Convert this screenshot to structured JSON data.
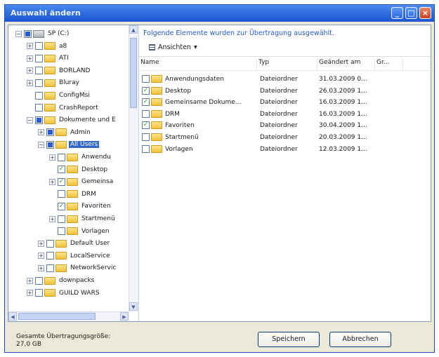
{
  "window": {
    "title": "Auswahl ändern"
  },
  "tree": {
    "rows": [
      {
        "label": "SP (C:)",
        "depth": 0,
        "exp": "−",
        "check": "part",
        "icon": "drive"
      },
      {
        "label": "a8",
        "depth": 1,
        "exp": "+",
        "check": "none",
        "icon": "folder"
      },
      {
        "label": "ATI",
        "depth": 1,
        "exp": "+",
        "check": "none",
        "icon": "folder"
      },
      {
        "label": "BORLAND",
        "depth": 1,
        "exp": "+",
        "check": "none",
        "icon": "folder"
      },
      {
        "label": "Bluray",
        "depth": 1,
        "exp": "+",
        "check": "none",
        "icon": "folder"
      },
      {
        "label": "ConfigMsi",
        "depth": 1,
        "exp": "",
        "check": "none",
        "icon": "folder"
      },
      {
        "label": "CrashReport",
        "depth": 1,
        "exp": "",
        "check": "none",
        "icon": "folder"
      },
      {
        "label": "Dokumente und E",
        "depth": 1,
        "exp": "−",
        "check": "part",
        "icon": "folder"
      },
      {
        "label": "Admin",
        "depth": 2,
        "exp": "+",
        "check": "part",
        "icon": "folder"
      },
      {
        "label": "All Users",
        "depth": 2,
        "exp": "−",
        "check": "part",
        "icon": "folder",
        "selected": true
      },
      {
        "label": "Anwendu",
        "depth": 3,
        "exp": "+",
        "check": "none",
        "icon": "folder"
      },
      {
        "label": "Desktop",
        "depth": 3,
        "exp": "",
        "check": "checked",
        "icon": "folder"
      },
      {
        "label": "Gemeinsa",
        "depth": 3,
        "exp": "+",
        "check": "checked",
        "icon": "folder"
      },
      {
        "label": "DRM",
        "depth": 3,
        "exp": "",
        "check": "none",
        "icon": "folder"
      },
      {
        "label": "Favoriten",
        "depth": 3,
        "exp": "",
        "check": "checked",
        "icon": "folder"
      },
      {
        "label": "Startmenü",
        "depth": 3,
        "exp": "+",
        "check": "none",
        "icon": "folder"
      },
      {
        "label": "Vorlagen",
        "depth": 3,
        "exp": "",
        "check": "none",
        "icon": "folder"
      },
      {
        "label": "Default User",
        "depth": 2,
        "exp": "+",
        "check": "none",
        "icon": "folder"
      },
      {
        "label": "LocalService",
        "depth": 2,
        "exp": "+",
        "check": "none",
        "icon": "folder"
      },
      {
        "label": "NetworkServic",
        "depth": 2,
        "exp": "+",
        "check": "none",
        "icon": "folder"
      },
      {
        "label": "downpacks",
        "depth": 1,
        "exp": "+",
        "check": "none",
        "icon": "folder"
      },
      {
        "label": "GUILD WARS",
        "depth": 1,
        "exp": "+",
        "check": "none",
        "icon": "folder"
      }
    ]
  },
  "main": {
    "headline": "Folgende Elemente wurden zur Übertragung ausgewählt.",
    "view_button": "Ansichten",
    "view_arrow": "▾",
    "columns": [
      "Name",
      "Typ",
      "Geändert am",
      "Gr..."
    ],
    "files": [
      {
        "name": "Anwendungsdaten",
        "type": "Dateiordner",
        "date": "31.03.2009 0...",
        "check": "none"
      },
      {
        "name": "Desktop",
        "type": "Dateiordner",
        "date": "26.03.2009 1...",
        "check": "checked"
      },
      {
        "name": "Gemeinsame Dokume...",
        "type": "Dateiordner",
        "date": "16.03.2009 1...",
        "check": "checked"
      },
      {
        "name": "DRM",
        "type": "Dateiordner",
        "date": "16.03.2009 1...",
        "check": "none"
      },
      {
        "name": "Favoriten",
        "type": "Dateiordner",
        "date": "30.04.2009 1...",
        "check": "checked"
      },
      {
        "name": "Startmenü",
        "type": "Dateiordner",
        "date": "20.03.2009 1...",
        "check": "none"
      },
      {
        "name": "Vorlagen",
        "type": "Dateiordner",
        "date": "12.03.2009 1...",
        "check": "none"
      }
    ]
  },
  "footer": {
    "size_label_1": "Gesamte Übertragungsgröße:",
    "size_label_2": "27,0 GB",
    "save_label": "Speichern",
    "cancel_label": "Abbrechen"
  }
}
